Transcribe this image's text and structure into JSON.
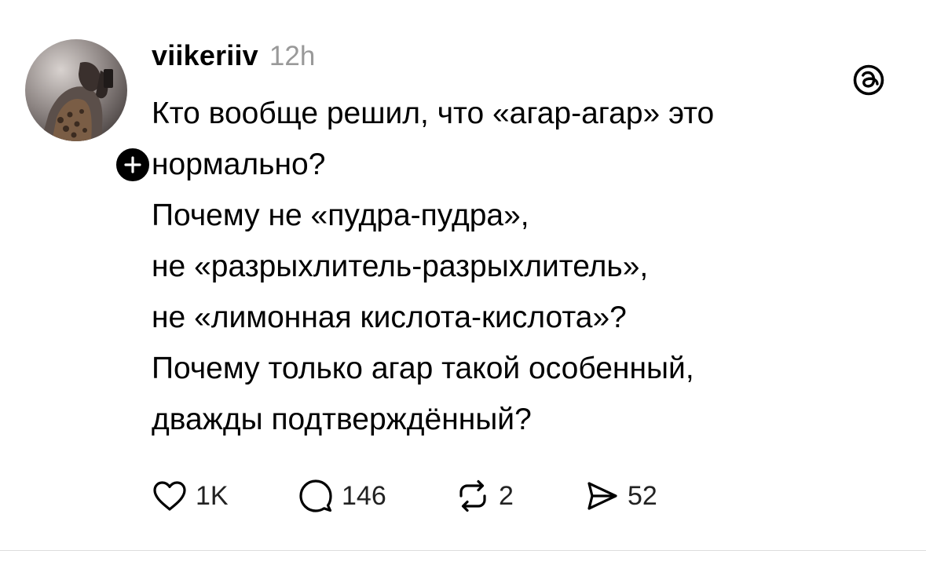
{
  "post": {
    "author": {
      "username": "viikeriiv",
      "timestamp": "12h",
      "avatar_icon": "profile-photo"
    },
    "app_logo_icon": "threads-logo-icon",
    "text_lines": [
      "Кто вообще решил, что «агар-агар» это",
      "нормально?",
      "Почему не «пудра-пудра»,",
      "не «разрыхлитель-разрыхлитель»,",
      "не «лимонная кислота-кислота»?",
      "Почему только агар такой особенный,",
      "дважды подтверждённый?"
    ],
    "actions": {
      "like_count": "1K",
      "reply_count": "146",
      "repost_count": "2",
      "share_count": "52"
    }
  }
}
